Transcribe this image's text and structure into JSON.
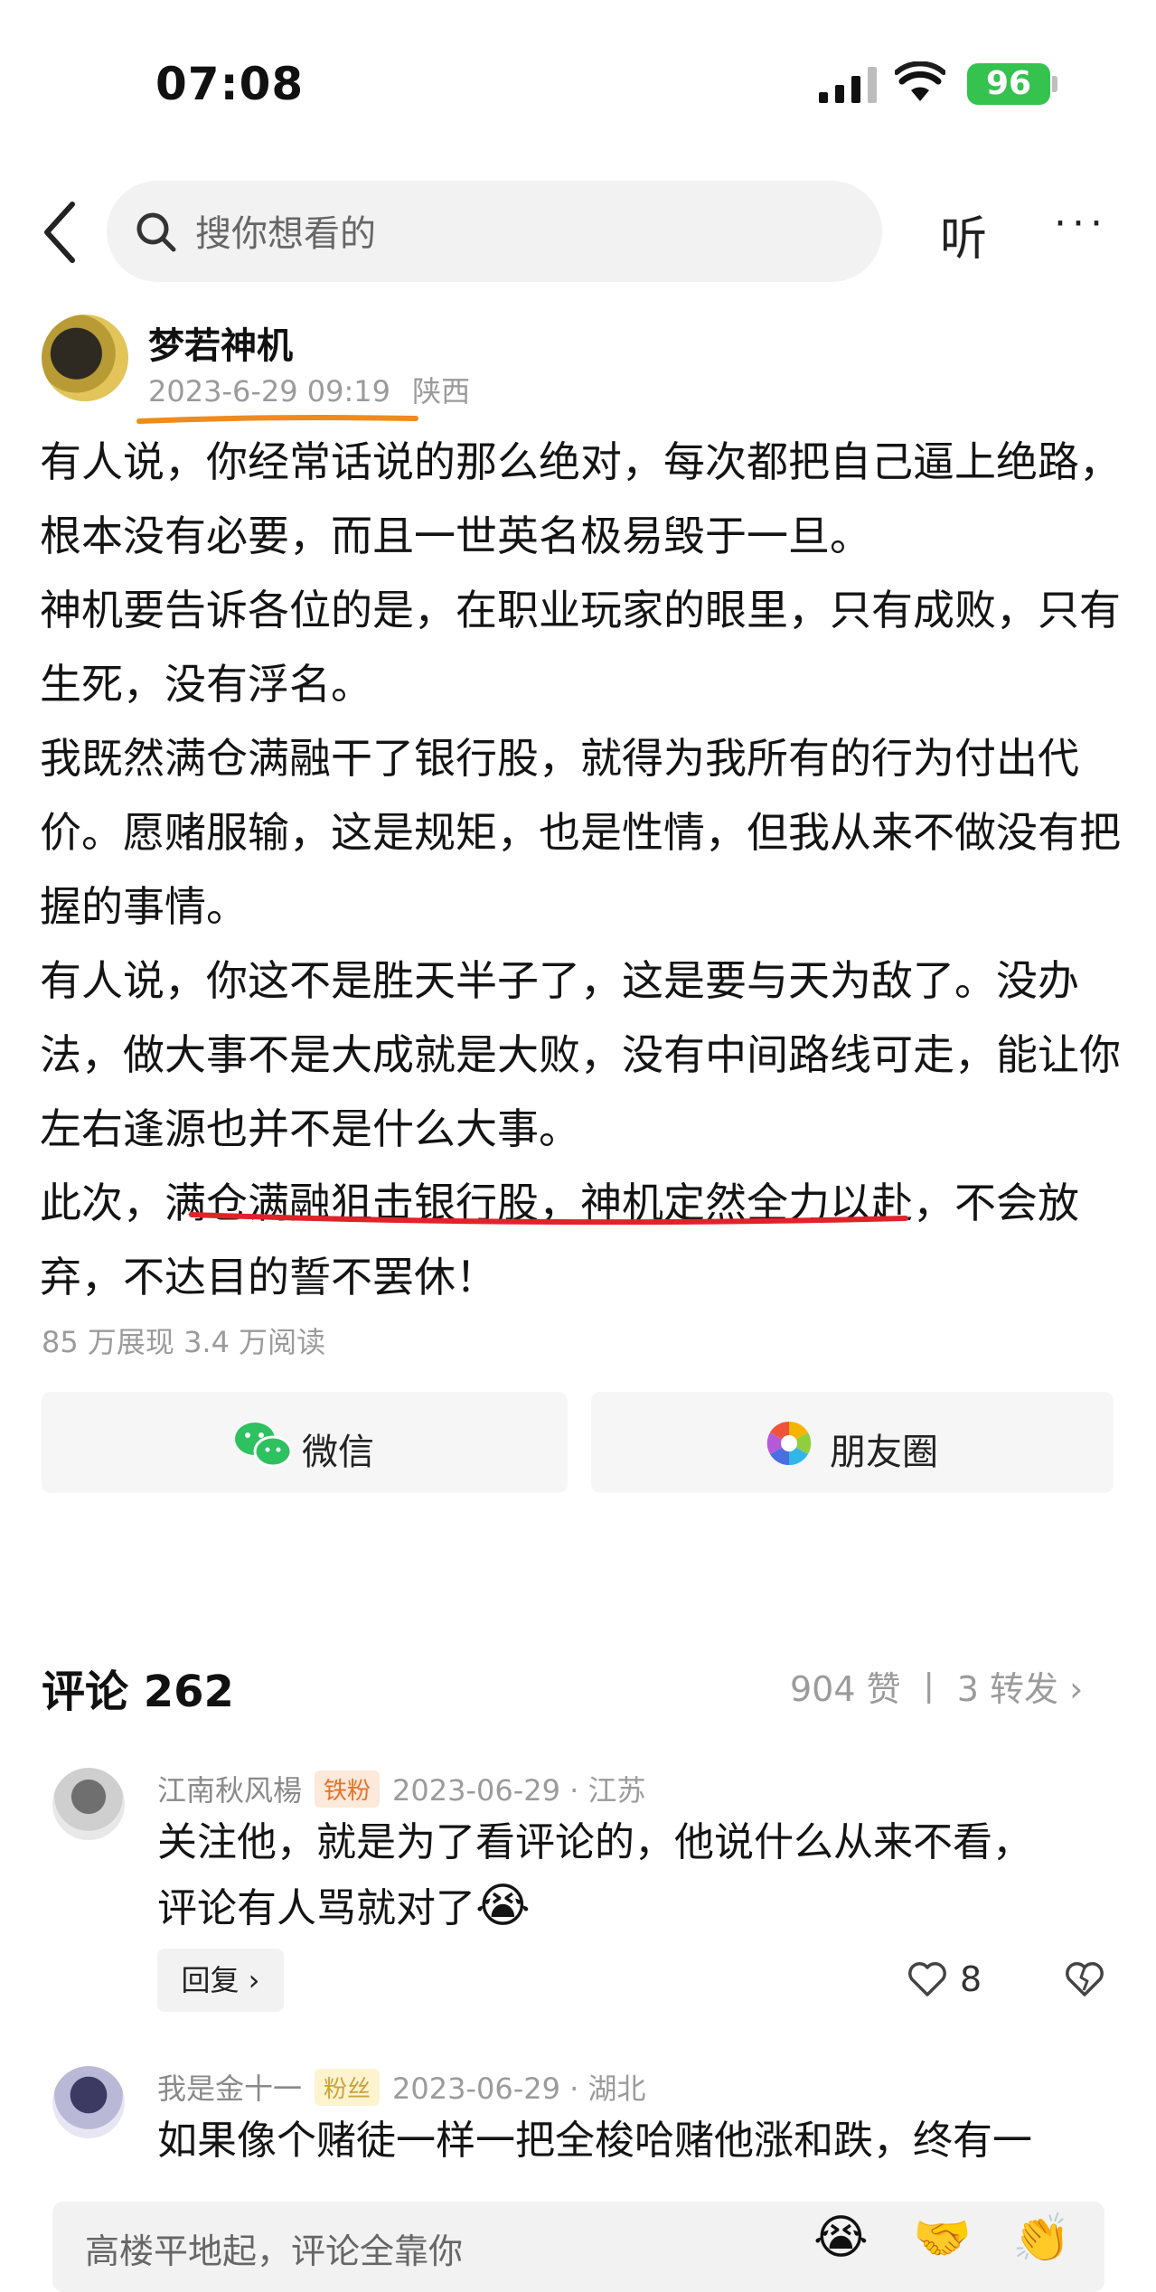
{
  "status_bar": {
    "time": "07:08",
    "battery": "96"
  },
  "nav": {
    "search_placeholder": "搜你想看的",
    "listen_label": "听",
    "more_label": "···"
  },
  "post": {
    "author": "梦若神机",
    "datetime": "2023-6-29 09:19",
    "location": "陕西",
    "paragraphs": [
      "有人说，你经常话说的那么绝对，每次都把自己逼上绝路，根本没有必要，而且一世英名极易毁于一旦。",
      "神机要告诉各位的是，在职业玩家的眼里，只有成败，只有生死，没有浮名。",
      "我既然满仓满融干了银行股，就得为我所有的行为付出代价。愿赌服输，这是规矩，也是性情，但我从来不做没有把握的事情。",
      "有人说，你这不是胜天半子了，这是要与天为敌了。没办法，做大事不是大成就是大败，没有中间路线可走，能让你左右逢源也并不是什么大事。",
      "此次，满仓满融狙击银行股，神机定然全力以赴，不会放弃，不达目的誓不罢休！"
    ],
    "stats": "85 万展现   3.4 万阅读"
  },
  "share": {
    "wechat": "微信",
    "moments": "朋友圈"
  },
  "comments": {
    "title": "评论 262",
    "meta": "904 赞 丨 3 转发 ",
    "items": [
      {
        "name": "江南秋风楊",
        "badge": "铁粉",
        "date": "2023-06-29 · 江苏",
        "text_line1": "关注他，就是为了看评论的，他说什么从来不看，",
        "text_line2": "评论有人骂就对了",
        "emoji": "😭",
        "reply_label": "回复 ›",
        "likes": "8"
      },
      {
        "name": "我是金十一",
        "badge": "粉丝",
        "date": "2023-06-29 · 湖北",
        "text_line1": "如果像个赌徒一样一把全梭哈赌他涨和跌，终有一"
      }
    ]
  },
  "input": {
    "placeholder": "高楼平地起，评论全靠你",
    "emojis": [
      "😭",
      "🤝",
      "👏"
    ]
  },
  "colors": {
    "accent_orange": "#f08a1c",
    "accent_red": "#e0232a",
    "battery_green": "#35c24f"
  }
}
